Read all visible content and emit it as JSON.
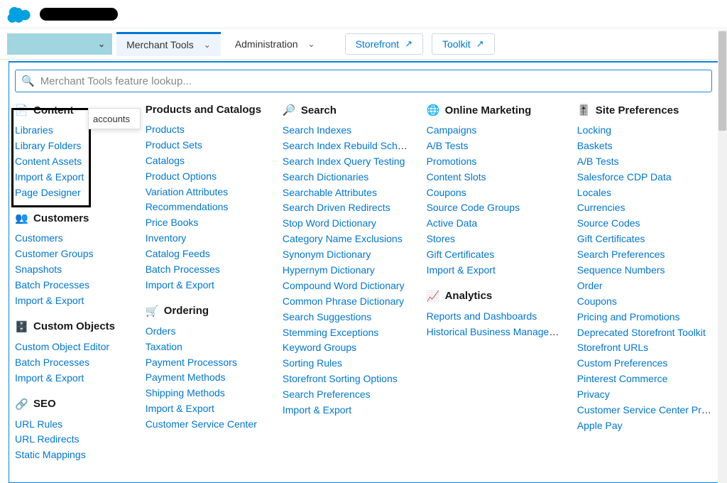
{
  "nav": {
    "merchant_tools": "Merchant Tools",
    "administration": "Administration",
    "storefront": "Storefront",
    "toolkit": "Toolkit"
  },
  "search": {
    "placeholder": "Merchant Tools feature lookup..."
  },
  "popup": {
    "accounts": "accounts"
  },
  "sections": {
    "content": {
      "title": "Content",
      "links": [
        "Libraries",
        "Library Folders",
        "Content Assets",
        "Import & Export",
        "Page Designer"
      ]
    },
    "customers": {
      "title": "Customers",
      "links": [
        "Customers",
        "Customer Groups",
        "Snapshots",
        "Batch Processes",
        "Import & Export"
      ]
    },
    "custom_objects": {
      "title": "Custom Objects",
      "links": [
        "Custom Object Editor",
        "Batch Processes",
        "Import & Export"
      ]
    },
    "seo": {
      "title": "SEO",
      "links": [
        "URL Rules",
        "URL Redirects",
        "Static Mappings"
      ]
    },
    "products": {
      "title": "Products and Catalogs",
      "links": [
        "Products",
        "Product Sets",
        "Catalogs",
        "Product Options",
        "Variation Attributes",
        "Recommendations",
        "Price Books",
        "Inventory",
        "Catalog Feeds",
        "Batch Processes",
        "Import & Export"
      ]
    },
    "ordering": {
      "title": "Ordering",
      "links": [
        "Orders",
        "Taxation",
        "Payment Processors",
        "Payment Methods",
        "Shipping Methods",
        "Import & Export",
        "Customer Service Center"
      ]
    },
    "search_sect": {
      "title": "Search",
      "links": [
        "Search Indexes",
        "Search Index Rebuild Schedule",
        "Search Index Query Testing",
        "Search Dictionaries",
        "Searchable Attributes",
        "Search Driven Redirects",
        "Stop Word Dictionary",
        "Category Name Exclusions",
        "Synonym Dictionary",
        "Hypernym Dictionary",
        "Compound Word Dictionary",
        "Common Phrase Dictionary",
        "Search Suggestions",
        "Stemming Exceptions",
        "Keyword Groups",
        "Sorting Rules",
        "Storefront Sorting Options",
        "Search Preferences",
        "Import & Export"
      ]
    },
    "online_marketing": {
      "title": "Online Marketing",
      "links": [
        "Campaigns",
        "A/B Tests",
        "Promotions",
        "Content Slots",
        "Coupons",
        "Source Code Groups",
        "Active Data",
        "Stores",
        "Gift Certificates",
        "Import & Export"
      ]
    },
    "analytics": {
      "title": "Analytics",
      "links": [
        "Reports and Dashboards",
        "Historical Business Manager Repo..."
      ]
    },
    "site_prefs": {
      "title": "Site Preferences",
      "links": [
        "Locking",
        "Baskets",
        "A/B Tests",
        "Salesforce CDP Data",
        "Locales",
        "Currencies",
        "Source Codes",
        "Gift Certificates",
        "Search Preferences",
        "Sequence Numbers",
        "Order",
        "Coupons",
        "Pricing and Promotions",
        "Deprecated Storefront Toolkit",
        "Storefront URLs",
        "Custom Preferences",
        "Pinterest Commerce",
        "Privacy",
        "Customer Service Center Preferen...",
        "Apple Pay"
      ]
    }
  }
}
